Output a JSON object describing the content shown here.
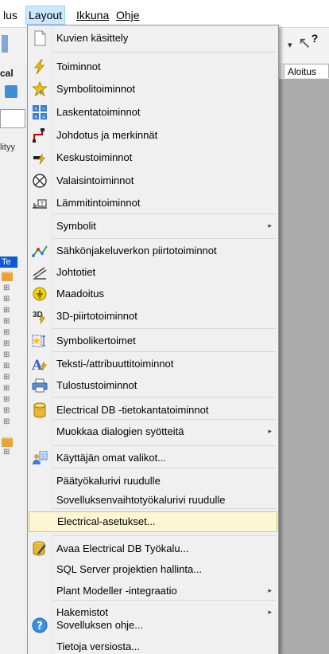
{
  "menubar": {
    "items": [
      {
        "label": "lus"
      },
      {
        "label": "Layout"
      },
      {
        "label": "Ikkuna"
      },
      {
        "label": "Ohje"
      }
    ]
  },
  "toolbar": {
    "arrow": "▾",
    "cursor": "↖",
    "cursor_q": "?"
  },
  "ribbon": {
    "tab_label": "Aloitus"
  },
  "left_panel": {
    "text_cal": "cal",
    "text_lityy": "lityy",
    "tree_tab": "Te"
  },
  "menu": {
    "items": [
      {
        "label": "Kuvien käsittely",
        "icon": "page-icon"
      },
      {
        "label": "Toiminnot",
        "icon": "lightning-icon"
      },
      {
        "label": "Symbolitoiminnot",
        "icon": "star-lightning-icon"
      },
      {
        "label": "Laskentatoiminnot",
        "icon": "calculator-icon"
      },
      {
        "label": "Johdotus ja merkinnät",
        "icon": "wiring-icon"
      },
      {
        "label": "Keskustoiminnot",
        "icon": "center-icon"
      },
      {
        "label": "Valaisintoiminnot",
        "icon": "lamp-icon"
      },
      {
        "label": "Lämmitintoiminnot",
        "icon": "heater-icon"
      },
      {
        "label": "Symbolit",
        "icon": "",
        "submenu": true
      },
      {
        "label": "Sähkönjakeluverkon piirtotoiminnot",
        "icon": "network-icon"
      },
      {
        "label": "Johtotiet",
        "icon": "cable-tray-icon"
      },
      {
        "label": "Maadoitus",
        "icon": "earthing-icon"
      },
      {
        "label": "3D-piirtotoiminnot",
        "icon": "3d-icon"
      },
      {
        "label": "Symbolikertoimet",
        "icon": "symbol-factor-icon"
      },
      {
        "label": "Teksti-/attribuuttitoiminnot",
        "icon": "text-attribute-icon"
      },
      {
        "label": "Tulostustoiminnot",
        "icon": "printer-icon"
      },
      {
        "label": "Electrical DB -tietokantatoiminnot",
        "icon": "database-icon"
      },
      {
        "label": "Muokkaa dialogien syötteitä",
        "icon": "",
        "submenu": true
      },
      {
        "label": "Käyttäjän omat valikot...",
        "icon": "user-menu-icon"
      },
      {
        "label": "Päätyökalurivi ruudulle",
        "icon": ""
      },
      {
        "label": "Sovelluksenvaihtotyökalurivi ruudulle",
        "icon": ""
      },
      {
        "label": "Electrical-asetukset...",
        "icon": "",
        "highlighted": true
      },
      {
        "label": "Avaa Electrical DB Työkalu...",
        "icon": "db-tool-icon"
      },
      {
        "label": "SQL Server projektien hallinta...",
        "icon": ""
      },
      {
        "label": "Plant Modeller -integraatio",
        "icon": "",
        "submenu": true
      },
      {
        "label": "Hakemistot",
        "icon": "",
        "submenu": true
      },
      {
        "label": "Sovelluksen ohje...",
        "icon": "help-icon"
      },
      {
        "label": "Tietoja versiosta...",
        "icon": ""
      }
    ],
    "submenu_glyph": "▸"
  }
}
